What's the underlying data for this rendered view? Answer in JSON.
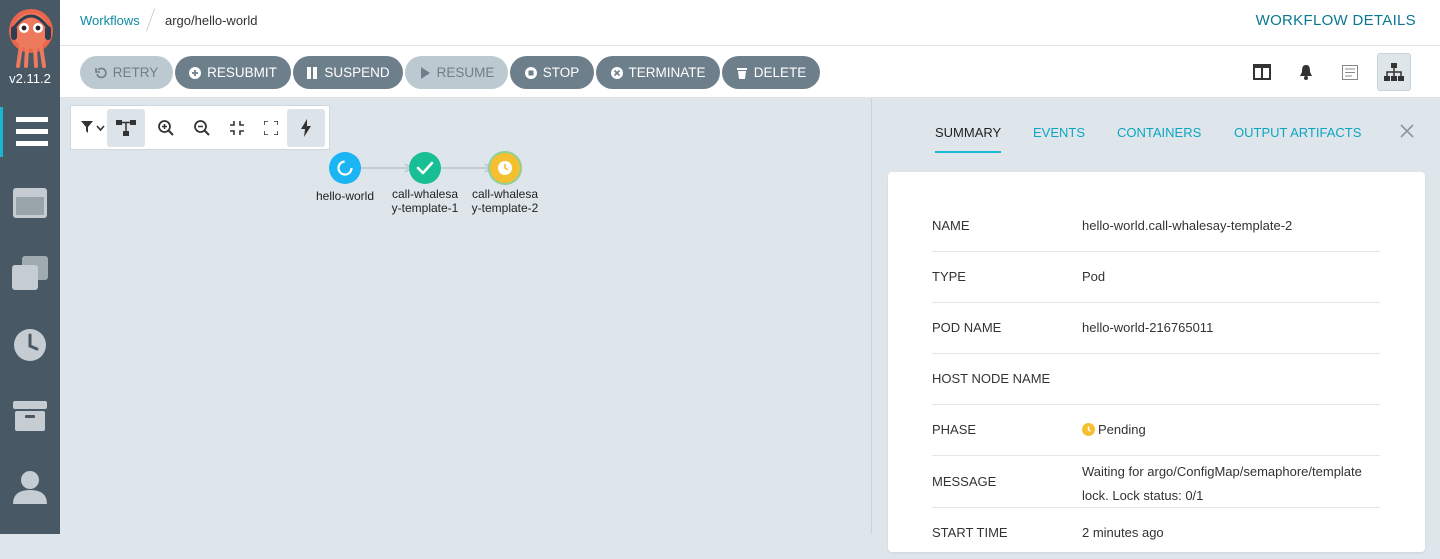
{
  "app": {
    "version": "v2.11.2"
  },
  "breadcrumb": {
    "parent": "Workflows",
    "current": "argo/hello-world"
  },
  "page_title": "WORKFLOW DETAILS",
  "toolbar": {
    "buttons": [
      {
        "label": "RETRY",
        "icon": "retry-icon",
        "disabled": true
      },
      {
        "label": "RESUBMIT",
        "icon": "plus-circle-icon",
        "disabled": false
      },
      {
        "label": "SUSPEND",
        "icon": "pause-icon",
        "disabled": false
      },
      {
        "label": "RESUME",
        "icon": "play-icon",
        "disabled": true
      },
      {
        "label": "STOP",
        "icon": "stop-circle-icon",
        "disabled": false
      },
      {
        "label": "TERMINATE",
        "icon": "times-circle-icon",
        "disabled": false
      },
      {
        "label": "DELETE",
        "icon": "trash-icon",
        "disabled": false
      }
    ],
    "views": [
      "columns-icon",
      "bell-icon",
      "list-icon",
      "sitemap-icon"
    ],
    "active_view": "sitemap-icon"
  },
  "graph": {
    "nodes": [
      {
        "label": "hello-world",
        "status": "running"
      },
      {
        "label": "call-whalesay-template-1",
        "status": "succeeded"
      },
      {
        "label": "call-whalesay-template-2",
        "status": "pending"
      }
    ]
  },
  "panel": {
    "tabs": [
      "SUMMARY",
      "EVENTS",
      "CONTAINERS",
      "OUTPUT ARTIFACTS"
    ],
    "active_tab": "SUMMARY",
    "summary": [
      {
        "key": "NAME",
        "value": "hello-world.call-whalesay-template-2"
      },
      {
        "key": "TYPE",
        "value": "Pod"
      },
      {
        "key": "POD NAME",
        "value": "hello-world-216765011"
      },
      {
        "key": "HOST NODE NAME",
        "value": ""
      },
      {
        "key": "PHASE",
        "value": "Pending"
      },
      {
        "key": "MESSAGE",
        "value": "Waiting for argo/ConfigMap/semaphore/template lock. Lock status: 0/1"
      },
      {
        "key": "START TIME",
        "value": "2 minutes ago"
      }
    ]
  },
  "colors": {
    "accent": "#18b8d0",
    "running": "#1bb5f4",
    "succeeded": "#18be94",
    "pending": "#f4c030",
    "sidebar": "#495865"
  }
}
